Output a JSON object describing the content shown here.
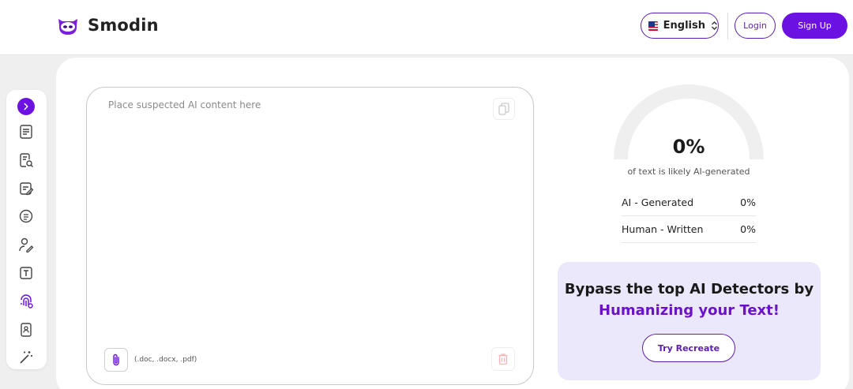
{
  "header": {
    "brand": "Smodin",
    "language": "English",
    "login_label": "Login",
    "signup_label": "Sign Up"
  },
  "sidebar": {
    "items": [
      {
        "icon": "chevron-right-icon"
      },
      {
        "icon": "document-lines-icon"
      },
      {
        "icon": "document-search-icon"
      },
      {
        "icon": "document-edit-icon"
      },
      {
        "icon": "summary-icon"
      },
      {
        "icon": "user-pen-icon"
      },
      {
        "icon": "text-box-icon"
      },
      {
        "icon": "fingerprint-icon"
      },
      {
        "icon": "document-user-icon"
      },
      {
        "icon": "magic-wand-icon"
      }
    ]
  },
  "editor": {
    "placeholder": "Place suspected AI content here",
    "file_types": "(.doc, .docx, .pdf)"
  },
  "result": {
    "percent": "0%",
    "percent_value": 0,
    "caption": "of text is likely AI-generated",
    "rows": [
      {
        "label": "AI - Generated",
        "value": "0%"
      },
      {
        "label": "Human - Written",
        "value": "0%"
      }
    ]
  },
  "promo": {
    "line1": "Bypass the top AI Detectors by",
    "line2": "Humanizing your Text!",
    "button": "Try Recreate"
  },
  "colors": {
    "accent": "#6b12e3",
    "accent_dark": "#5b1fb0",
    "promo_bg": "#ece8fb",
    "gauge_track": "#efefef"
  }
}
